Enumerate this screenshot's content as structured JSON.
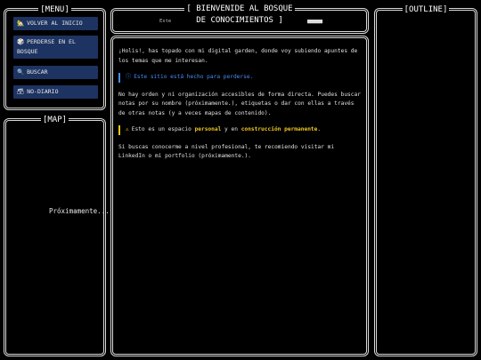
{
  "menu": {
    "title": "[MENU]",
    "items": [
      {
        "icon": "🏡",
        "label": "VOLVER AL INICIO"
      },
      {
        "icon": "🎲",
        "label": "PERDERSE EN EL BOSQUE"
      },
      {
        "icon": "🔍",
        "label": "BUSCAR"
      },
      {
        "icon": "🗃",
        "label": "NO-DIARIO"
      }
    ]
  },
  "map": {
    "title": "[MAP]",
    "placeholder": "Próximamente..."
  },
  "header": {
    "title": "[ BIENVENIDE AL BOSQUE",
    "subtitle": "DE CONOCIMIENTOS ]",
    "small_label": "Este",
    "dots": "■■■■■"
  },
  "outline": {
    "title": "[OUTLINE]"
  },
  "main": {
    "intro": "¡Holis!, has topado con mi digital garden, donde voy subiendo apuntes de los temas que me interesan.",
    "callout_info": "Este sitio está hecho para perderse.",
    "paragraph2": "No hay orden y ni organización accesibles de forma directa. Puedes buscar notas por su nombre (próximamente.), etiquetas o dar con ellas a través de otras notas (y a veces mapas de contenido).",
    "callout_warn": {
      "prefix": "Esto es un espacio ",
      "hl1": "personal",
      "mid": " y en ",
      "hl2": "construcción permanente",
      "suffix": "."
    },
    "paragraph3": "Si buscas conocerme a nivel profesional, te recomiendo visitar mi LinkedIn o mi portfolio (próximamente.)."
  },
  "colors": {
    "accent_blue": "#4c8bf5",
    "warn_yellow": "#f3c623",
    "menu_button": "#1d3361"
  }
}
